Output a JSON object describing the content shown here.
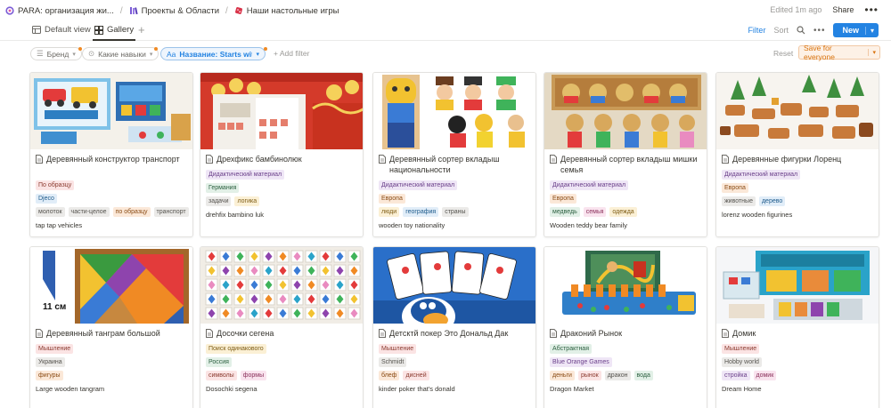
{
  "breadcrumb": {
    "items": [
      "PARA: организация жи...",
      "Проекты & Области",
      "Наши настольные игры"
    ]
  },
  "header": {
    "edited": "Edited 1m ago",
    "share": "Share",
    "more": "•••"
  },
  "tabs": {
    "default": "Default view",
    "gallery": "Gallery",
    "add": "+"
  },
  "actions": {
    "filter": "Filter",
    "sort": "Sort",
    "new": "New"
  },
  "filters": {
    "brand": "Бренд",
    "skills": "Какие навыки",
    "name_prefix": "Aa",
    "name": "Название: Starts with Д",
    "add_filter": "Add filter",
    "reset": "Reset",
    "save": "Save for everyone"
  },
  "colors": {
    "accent": "#2383e2",
    "warning": "#d9730d"
  },
  "cards": [
    {
      "title": "Деревянный конструктор транспорт",
      "rows": [
        [
          {
            "t": "По образцу",
            "c": "red"
          }
        ],
        [
          {
            "t": "Djeco",
            "c": "blue"
          }
        ],
        [
          {
            "t": "молоток",
            "c": "gray"
          },
          {
            "t": "части-целое",
            "c": "gray"
          },
          {
            "t": "по образцу",
            "c": "orange"
          },
          {
            "t": "транспорт",
            "c": "gray"
          }
        ]
      ],
      "note": "tap tap vehicles",
      "cover": "vehicles"
    },
    {
      "title": "Дрехфикс бамбинолюк",
      "rows": [
        [
          {
            "t": "Дидактический материал",
            "c": "purple"
          }
        ],
        [
          {
            "t": "Германия",
            "c": "green"
          }
        ],
        [
          {
            "t": "задачи",
            "c": "gray"
          },
          {
            "t": "логика",
            "c": "yellow"
          }
        ]
      ],
      "note": "drehfix bambino luk",
      "cover": "bambino"
    },
    {
      "title": "Деревянный сортер вкладыш национальности",
      "rows": [
        [
          {
            "t": "Дидактический материал",
            "c": "purple"
          }
        ],
        [
          {
            "t": "Европа",
            "c": "orange"
          }
        ],
        [
          {
            "t": "люди",
            "c": "yellow"
          },
          {
            "t": "география",
            "c": "blue"
          },
          {
            "t": "страны",
            "c": "gray"
          }
        ]
      ],
      "note": "wooden toy nationality",
      "cover": "nationality"
    },
    {
      "title": "Деревянный сортер вкладыш мишки семья",
      "rows": [
        [
          {
            "t": "Дидактический материал",
            "c": "purple"
          }
        ],
        [
          {
            "t": "Европа",
            "c": "orange"
          }
        ],
        [
          {
            "t": "медведь",
            "c": "green"
          },
          {
            "t": "семья",
            "c": "pink"
          },
          {
            "t": "одежда",
            "c": "yellow"
          }
        ]
      ],
      "note": "Wooden teddy bear family",
      "cover": "bears"
    },
    {
      "title": "Деревянные фигурки Лоренц",
      "rows": [
        [
          {
            "t": "Дидактический материал",
            "c": "purple"
          }
        ],
        [
          {
            "t": "Европа",
            "c": "orange"
          }
        ],
        [
          {
            "t": "животные",
            "c": "gray"
          },
          {
            "t": "дерево",
            "c": "blue"
          }
        ]
      ],
      "note": "lorenz wooden figurines",
      "cover": "animals"
    },
    {
      "title": "Деревянный танграм большой",
      "rows": [
        [
          {
            "t": "Мышление",
            "c": "red"
          }
        ],
        [
          {
            "t": "Украина",
            "c": "gray"
          }
        ],
        [
          {
            "t": "фигуры",
            "c": "orange"
          }
        ]
      ],
      "note": "Large wooden tangram",
      "cover": "tangram",
      "cover_label": "11 см"
    },
    {
      "title": "Досочки сегена",
      "rows": [
        [
          {
            "t": "Поиск одинакового",
            "c": "yellow"
          }
        ],
        [
          {
            "t": "Россия",
            "c": "green"
          }
        ],
        [
          {
            "t": "символы",
            "c": "red"
          },
          {
            "t": "формы",
            "c": "pink"
          }
        ]
      ],
      "note": "Dosochki segena",
      "cover": "segen"
    },
    {
      "title": "Детсктй покер Это Дональд Дак",
      "rows": [
        [
          {
            "t": "Мышление",
            "c": "red"
          }
        ],
        [
          {
            "t": "Schmidt",
            "c": "gray"
          }
        ],
        [
          {
            "t": "блеф",
            "c": "orange"
          },
          {
            "t": "дисней",
            "c": "red"
          }
        ]
      ],
      "note": "kinder poker that's donald",
      "cover": "poker"
    },
    {
      "title": "Драконий Рынок",
      "rows": [
        [
          {
            "t": "Абстрактная",
            "c": "green"
          }
        ],
        [
          {
            "t": "Blue Orange Games",
            "c": "purple"
          }
        ],
        [
          {
            "t": "деньги",
            "c": "orange"
          },
          {
            "t": "рынок",
            "c": "red"
          },
          {
            "t": "дракон",
            "c": "gray"
          },
          {
            "t": "вода",
            "c": "green"
          }
        ]
      ],
      "note": "Dragon Market",
      "cover": "dragon"
    },
    {
      "title": "Домик",
      "rows": [
        [
          {
            "t": "Мышление",
            "c": "red"
          }
        ],
        [
          {
            "t": "Hobby world",
            "c": "gray"
          }
        ],
        [
          {
            "t": "стройка",
            "c": "purple"
          },
          {
            "t": "домик",
            "c": "pink"
          }
        ]
      ],
      "note": "Dream Home",
      "cover": "domik"
    }
  ]
}
